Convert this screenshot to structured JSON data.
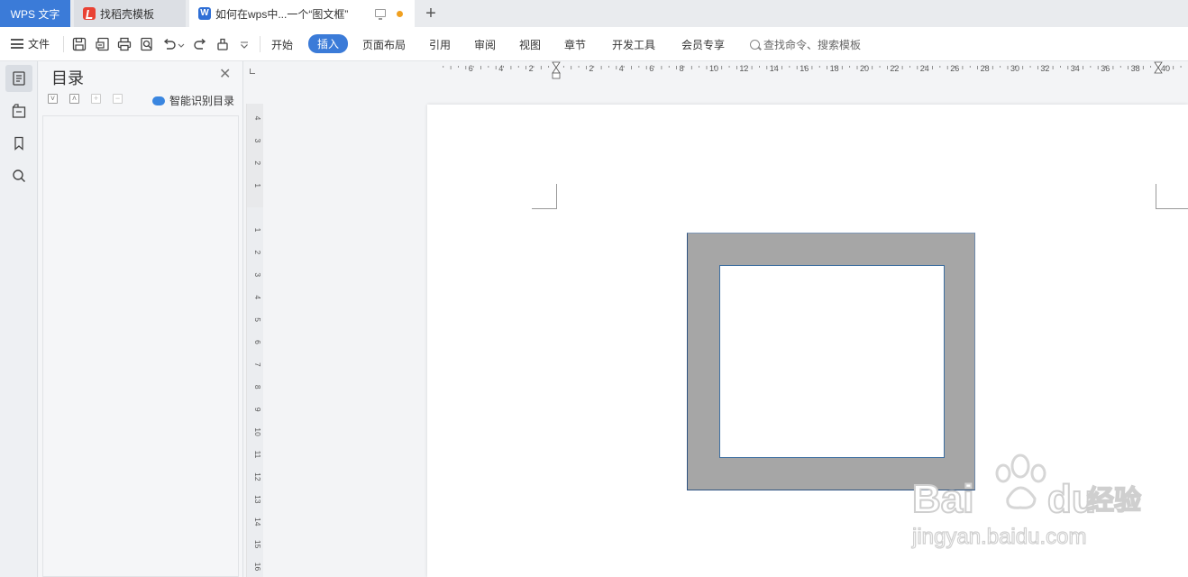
{
  "tabs": {
    "wps_label": "WPS 文字",
    "templates_label": "找稻壳模板",
    "document_label": "如何在wps中...一个“图文框”"
  },
  "toolbar": {
    "file_label": "文件",
    "menu_tabs": [
      "开始",
      "插入",
      "页面布局",
      "引用",
      "审阅",
      "视图",
      "章节",
      "开发工具",
      "会员专享"
    ],
    "active_tab": "插入",
    "search_placeholder": "查找命令、搜索模板"
  },
  "toc": {
    "title": "目录",
    "smart_label": "智能识别目录"
  },
  "rulers": {
    "horizontal_ticks": [
      "6",
      "4",
      "2",
      "2",
      "4",
      "6",
      "8",
      "10",
      "12",
      "14",
      "16",
      "18",
      "20",
      "22",
      "24",
      "26",
      "28",
      "30",
      "32",
      "34",
      "36",
      "38",
      "40"
    ],
    "vertical_ticks_top": [
      "4",
      "3",
      "2",
      "1"
    ],
    "vertical_ticks_body": [
      "1",
      "2",
      "3",
      "4",
      "5",
      "6",
      "7",
      "8",
      "9",
      "10",
      "11",
      "12",
      "13",
      "14",
      "15",
      "16"
    ]
  },
  "watermark": {
    "brand_left": "Bai",
    "brand_right": "du",
    "brand_cn": "经验",
    "url": "jingyan.baidu.com"
  },
  "colors": {
    "accent": "#3b7bd8",
    "frame_fill": "#a6a6a6",
    "frame_border": "#2e5280",
    "unsaved_dot": "#f0a020"
  }
}
